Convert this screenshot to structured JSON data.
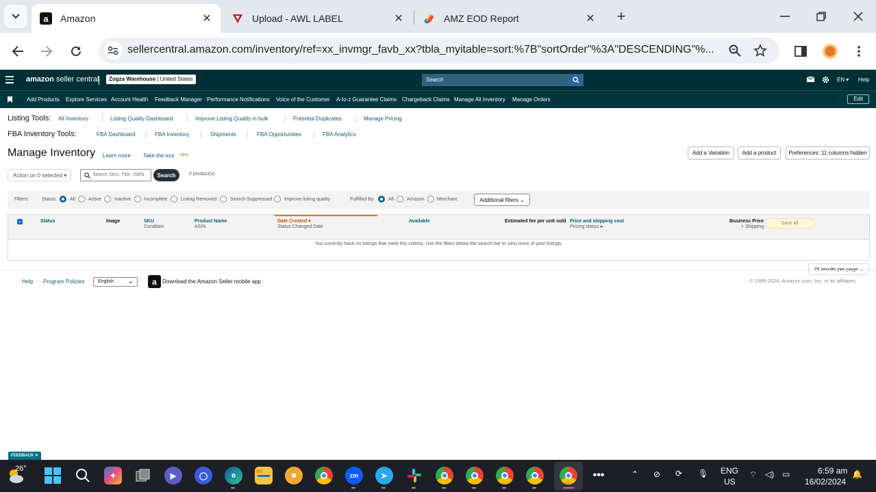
{
  "browser": {
    "tabs": [
      {
        "title": "Amazon",
        "active": true
      },
      {
        "title": "Upload - AWL LABEL",
        "active": false
      },
      {
        "title": "AMZ EOD Report",
        "active": false
      }
    ],
    "url": "sellercentral.amazon.com/inventory/ref=xx_invmgr_favb_xx?tbla_myitable=sort:%7B\"sortOrder\"%3A\"DESCENDING\"%..."
  },
  "header": {
    "logo_bold": "amazon",
    "logo_light": " seller central",
    "store_name": "Zogza Warehouse",
    "store_region": "United States",
    "search_placeholder": "Search",
    "lang": "EN",
    "help": "Help"
  },
  "nav": {
    "items": [
      "Add Products",
      "Explore Services",
      "Account Health",
      "Feedback Manager",
      "Performance Notifications",
      "Voice of the Customer",
      "A-to-z Guarantee Claims",
      "Chargeback Claims",
      "Manage All Inventory",
      "Manage Orders"
    ],
    "edit": "Edit"
  },
  "listing_tools": {
    "label": "Listing Tools:",
    "links": [
      "All Inventory",
      "Listing Quality Dashboard",
      "Improve Listing Quality in bulk",
      "Potential Duplicates",
      "Manage Pricing"
    ]
  },
  "fba_tools": {
    "label": "FBA Inventory Tools:",
    "links": [
      "FBA Dashboard",
      "FBA Inventory",
      "Shipments",
      "FBA Opportunities",
      "FBA Analytics"
    ]
  },
  "page": {
    "title": "Manage Inventory",
    "learn_more": "Learn more",
    "take_tour": "Take the tour",
    "new_badge": "NEW",
    "add_variation": "Add a Variation",
    "add_product": "Add a product",
    "preferences": "Preferences: 11 columns hidden",
    "action_select": "Action on 0 selected",
    "search_placeholder": "Search SKU, Title, ISBN",
    "search_button": "Search",
    "product_count": "0 product(s)"
  },
  "filters": {
    "label": "Filters:",
    "status_label": "Status:",
    "status_options": [
      "All",
      "Active",
      "Inactive",
      "Incomplete",
      "Listing Removed",
      "Search Suppressed",
      "Improve listing quality"
    ],
    "fulfilled_label": "Fulfilled By:",
    "fulfilled_options": [
      "All",
      "Amazon",
      "Merchant"
    ],
    "additional": "Additional filters"
  },
  "table": {
    "columns": {
      "status": "Status",
      "image": "Image",
      "sku": "SKU",
      "sku_sub": "Condition",
      "product_name": "Product Name",
      "product_sub": "ASIN",
      "date_created": "Date Created",
      "date_sub": "Status Changed Date",
      "available": "Available",
      "fee": "Estimated fee per unit sold",
      "price": "Price and shipping cost",
      "price_sub": "Pricing status",
      "business_price": "Business Price",
      "business_sub": "+ Shipping"
    },
    "save_all": "Save all",
    "empty_message": "You currently have no listings that meet this criteria. Use the filters below the search bar to view more of your listings."
  },
  "pagination": {
    "results_per_page": "25 results per page"
  },
  "footer": {
    "help": "Help",
    "program_policies": "Program Policies",
    "language": "English",
    "download_app": "Download the Amazon Seller mobile app",
    "copyright": "© 1999-2024, Amazon.com, Inc. or its affiliates"
  },
  "feedback": "FEEDBACK",
  "taskbar": {
    "temperature": "26°",
    "lang_line1": "ENG",
    "lang_line2": "US",
    "time": "6:59 am",
    "date": "16/02/2024"
  }
}
